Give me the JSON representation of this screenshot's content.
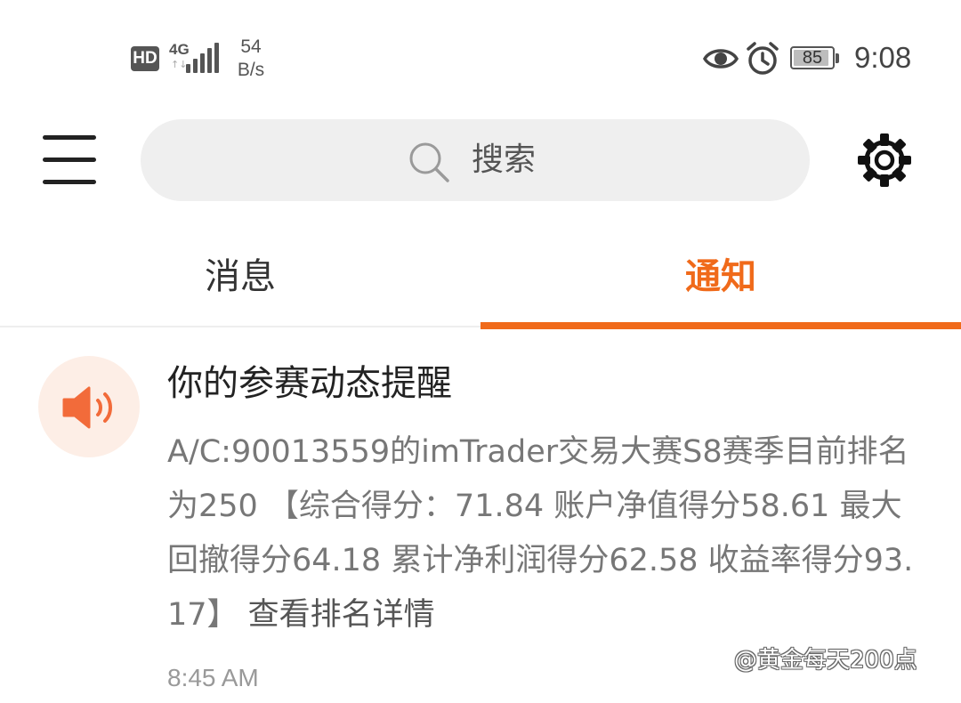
{
  "status_bar": {
    "hd_label": "HD",
    "network_type": "4G",
    "network_arrows": "↑↓",
    "net_speed_value": "54",
    "net_speed_unit": "B/s",
    "battery_level": "85",
    "time": "9:08"
  },
  "header": {
    "menu_icon": "menu-icon",
    "search_placeholder": "搜索",
    "settings_icon": "gear-icon"
  },
  "tabs": [
    {
      "label": "消息",
      "active": false
    },
    {
      "label": "通知",
      "active": true
    }
  ],
  "colors": {
    "accent": "#f06a1a",
    "avatar_bg": "#fdeee6",
    "speaker": "#f26b3a"
  },
  "notification": {
    "icon": "speaker-icon",
    "title": "你的参赛动态提醒",
    "body": "A/C:90013559的imTrader交易大赛S8赛季目前排名为250 【综合得分：71.84 账户净值得分58.61 最大回撤得分64.18 累计净利润得分62.58 收益率得分93.17】 ",
    "link_text": "查看排名详情",
    "time": "8:45 AM"
  },
  "watermark": "@黄金每天200点"
}
